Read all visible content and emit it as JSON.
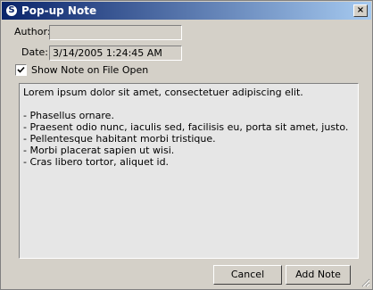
{
  "window": {
    "title": "Pop-up Note",
    "close_glyph": "×",
    "icon": "3ds-max-logo-icon",
    "icon_glyph": "S"
  },
  "form": {
    "author_label": "Author:",
    "author_value": "",
    "date_label": "Date:",
    "date_value": "3/14/2005 1:24:45 AM",
    "show_note_label": "Show Note on File Open",
    "show_note_checked": true
  },
  "note": {
    "lines": [
      "Lorem ipsum dolor sit amet, consectetuer adipiscing elit.",
      "",
      "- Phasellus ornare.",
      "- Praesent odio nunc, iaculis sed, facilisis eu, porta sit amet, justo.",
      "- Pellentesque habitant morbi tristique.",
      "- Morbi placerat sapien ut wisi.",
      "- Cras libero tortor, aliquet id."
    ]
  },
  "buttons": {
    "cancel_label": "Cancel",
    "add_note_label": "Add Note"
  }
}
